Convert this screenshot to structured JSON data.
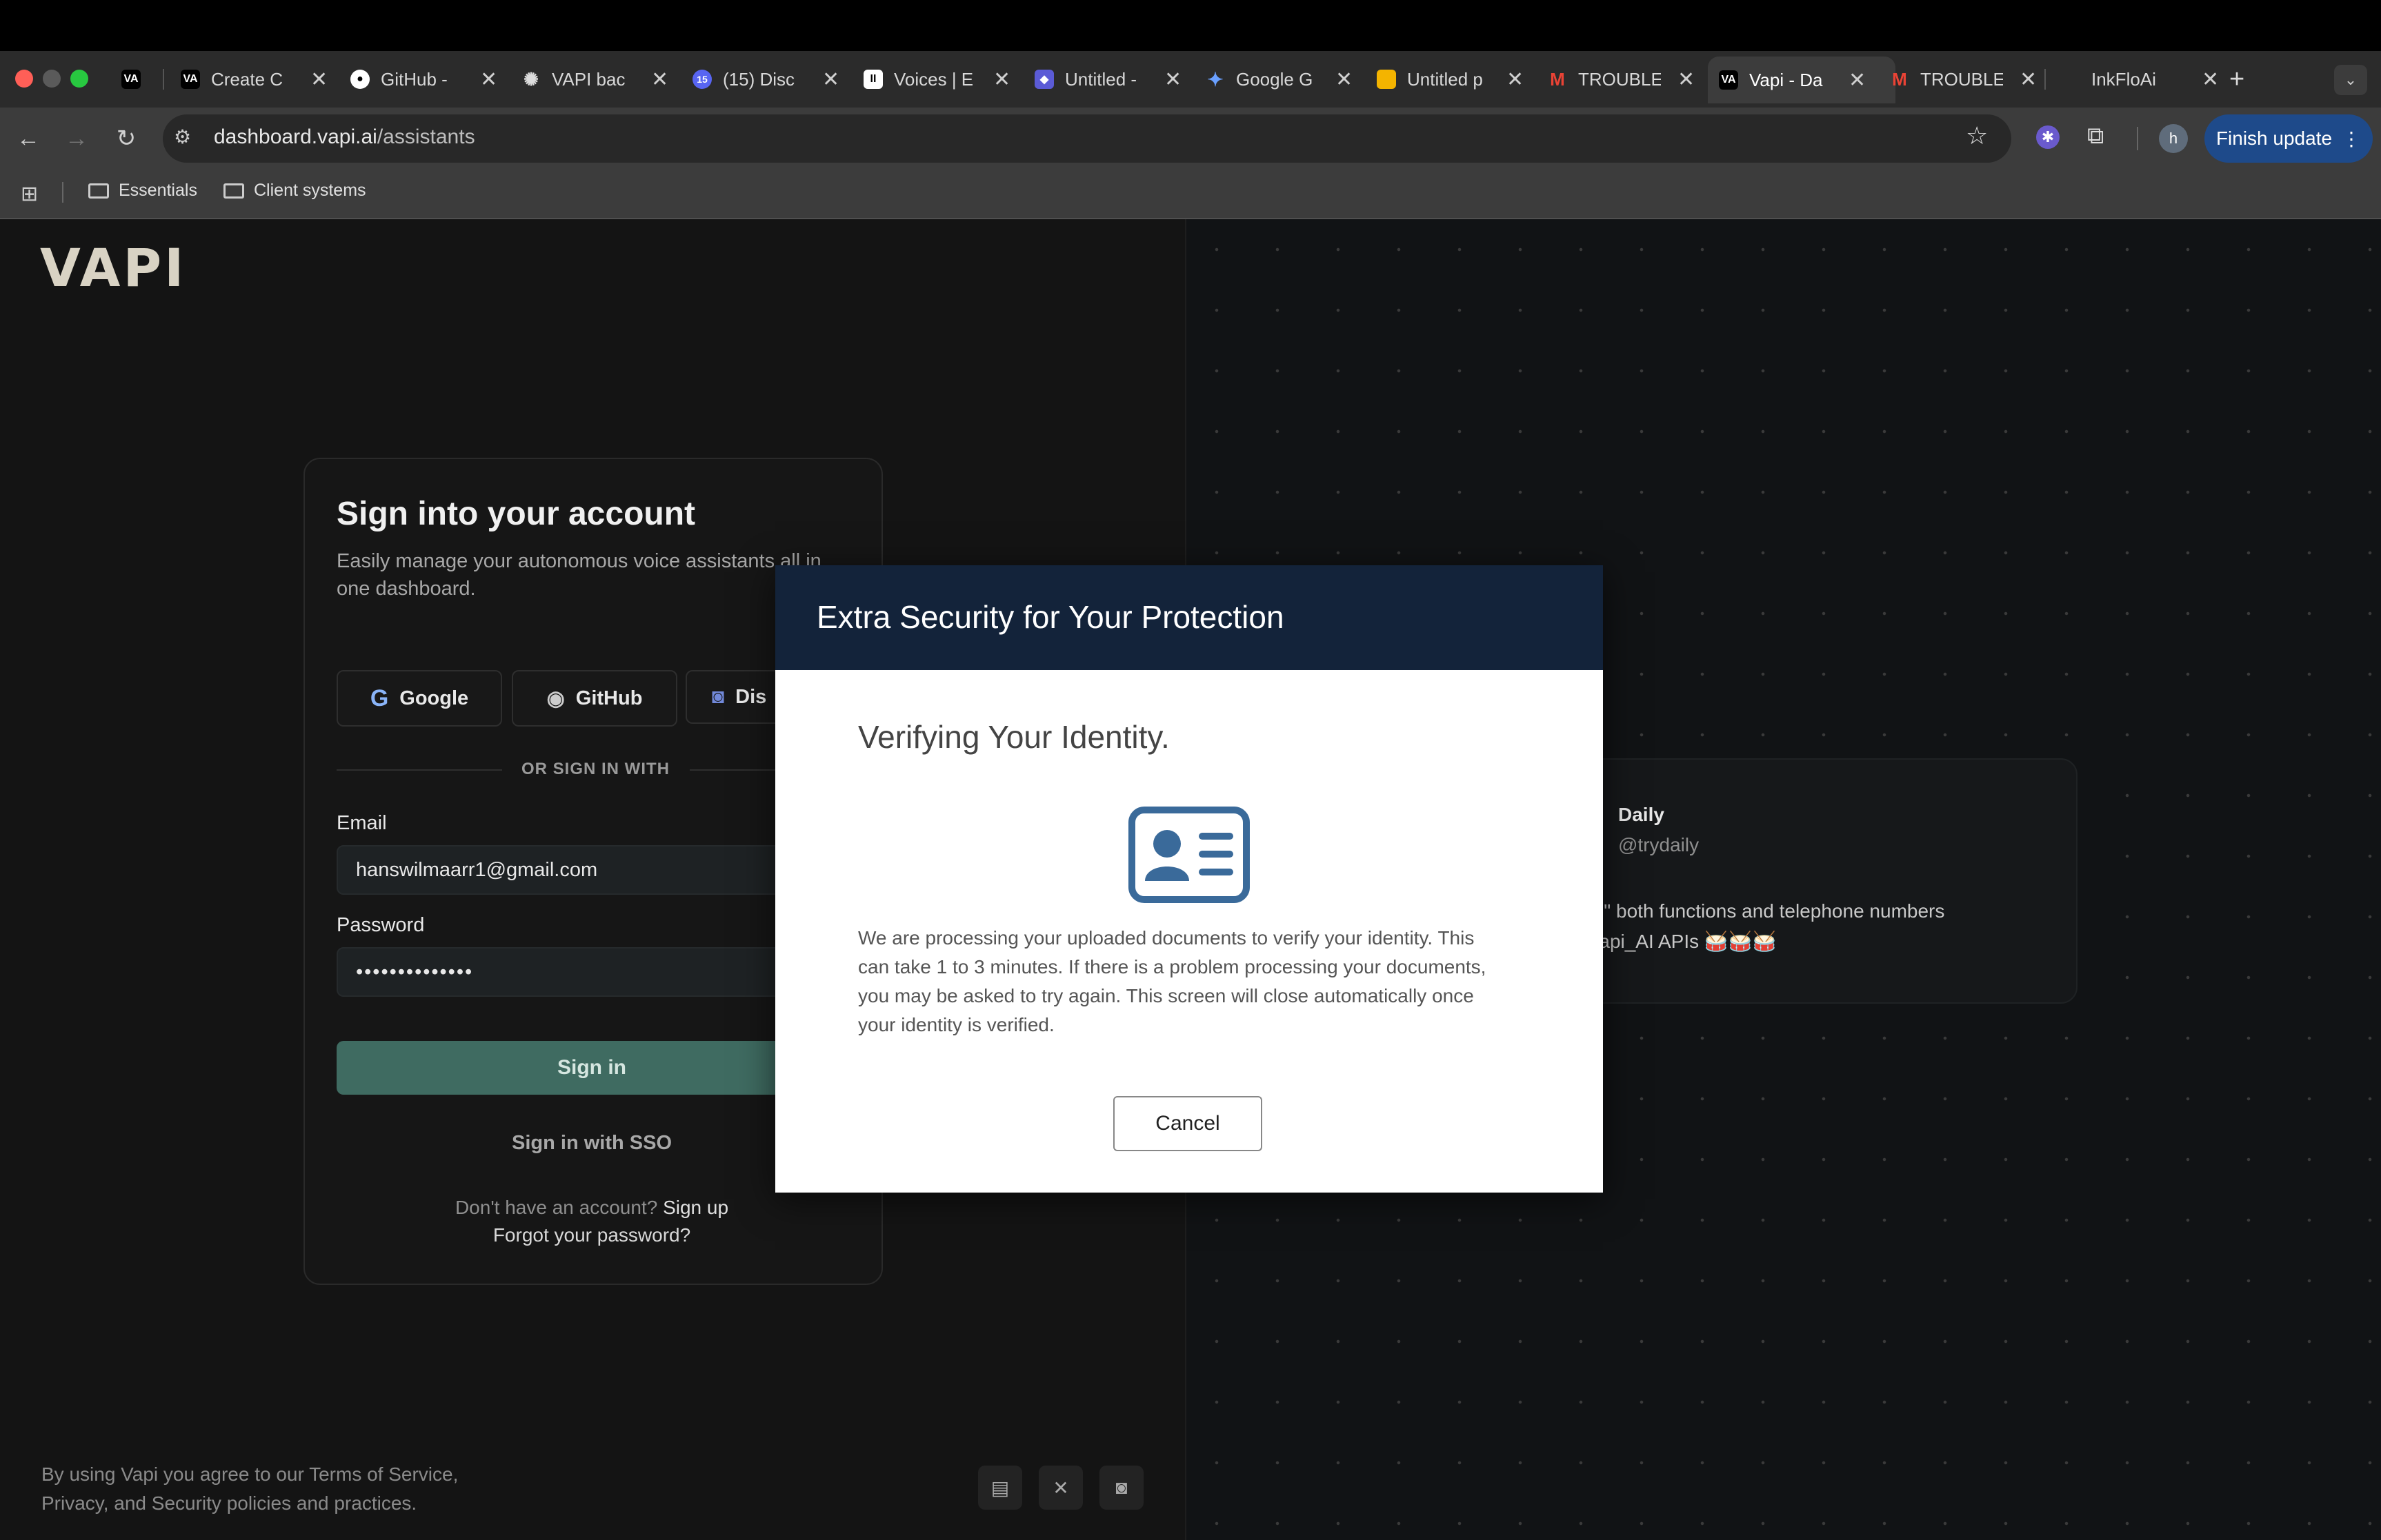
{
  "browser": {
    "tabs": [
      {
        "title": "",
        "favicon": "VA"
      },
      {
        "title": "Create C",
        "favicon": "VA"
      },
      {
        "title": "GitHub -",
        "favicon": "github-icon"
      },
      {
        "title": "VAPI bac",
        "favicon": "openai-icon"
      },
      {
        "title": "(15) Disc",
        "favicon": "15"
      },
      {
        "title": "Voices | E",
        "favicon": "II"
      },
      {
        "title": "Untitled -",
        "favicon": "app-icon"
      },
      {
        "title": "Google G",
        "favicon": "gemini-icon"
      },
      {
        "title": "Untitled p",
        "favicon": "slides-icon"
      },
      {
        "title": "TROUBLE",
        "favicon": "gmail-icon"
      },
      {
        "title": "Vapi - Da",
        "favicon": "VA"
      },
      {
        "title": "TROUBLE",
        "favicon": "gmail-icon"
      },
      {
        "title": "InkFloAi",
        "favicon": ""
      }
    ],
    "url_host": "dashboard.vapi.ai",
    "url_path": "/assistants",
    "profile_initial": "h",
    "finish_update": "Finish update",
    "bookmarks": [
      "Essentials",
      "Client systems"
    ]
  },
  "login": {
    "logo": "VAPI",
    "title": "Sign into your account",
    "subtitle": "Easily manage your autonomous voice assistants all in one dashboard.",
    "oauth": {
      "google": "Google",
      "github": "GitHub",
      "discord": "Dis"
    },
    "divider": "OR SIGN IN WITH",
    "email_label": "Email",
    "email_value": "hanswilmaarr1@gmail.com",
    "password_label": "Password",
    "password_value": "••••••••••••••",
    "signin": "Sign in",
    "sso": "Sign in with SSO",
    "no_account": "Don't have an account?",
    "signup": "Sign up",
    "forgot": "Forgot your password?",
    "terms": "By using Vapi you agree to our Terms of Service, Privacy, and Security policies and practices."
  },
  "tweet": {
    "name": "Daily",
    "handle": "@trydaily",
    "body_line1": "n \"call\" both functions and telephone numbers",
    "body_line2": "e @Vapi_AI APIs 🥁🥁🥁"
  },
  "modal": {
    "header": "Extra Security for Your Protection",
    "heading": "Verifying Your Identity.",
    "body": "We are processing your uploaded documents to verify your identity. This can take 1 to 3 minutes. If there is a problem processing your documents, you may be asked to try again. This screen will close automatically once your identity is verified.",
    "cancel": "Cancel",
    "icon_color": "#3a6a9a"
  }
}
